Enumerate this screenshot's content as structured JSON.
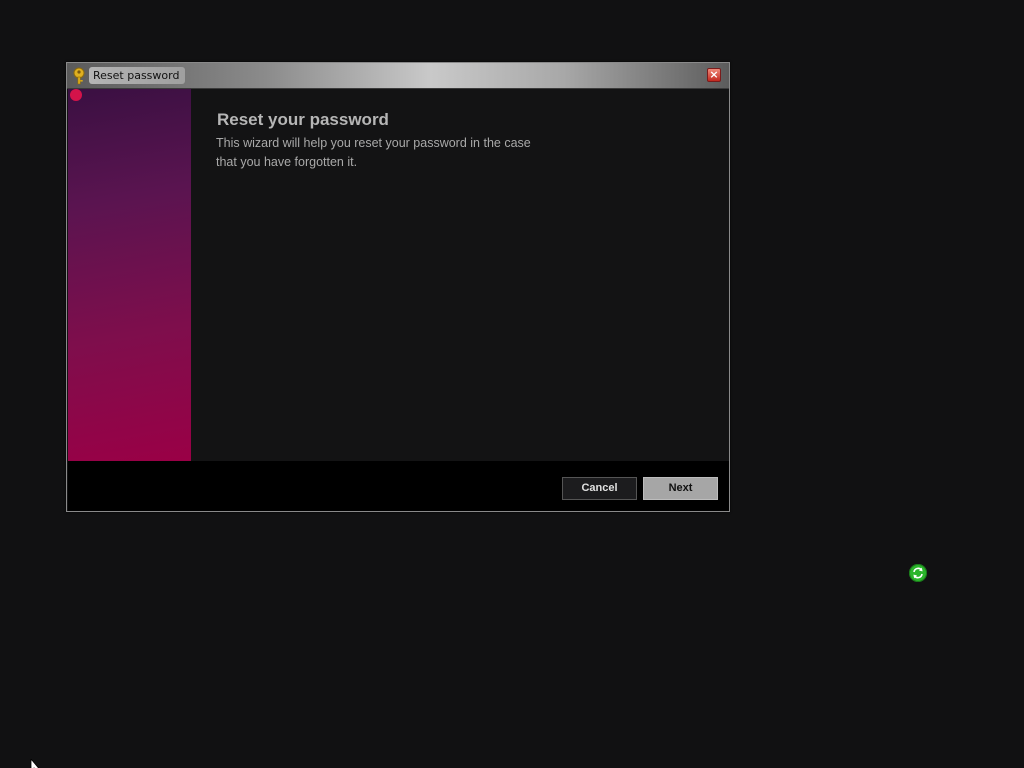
{
  "window": {
    "title": "Reset password",
    "close_symbol": "×"
  },
  "wizard": {
    "heading": "Reset your password",
    "description_line1": "This wizard will help you reset your password in the case",
    "description_line2": "that you have forgotten it."
  },
  "buttons": {
    "cancel": "Cancel",
    "next": "Next"
  },
  "icons": {
    "title_icon": "key-icon",
    "tray_icon": "sync-icon",
    "pointer": "mouse-cursor-icon"
  },
  "colors": {
    "desktop_bg": "#111112",
    "banner_top": "#3a1042",
    "banner_bottom": "#9a0046",
    "sync_green": "#2bb52b"
  }
}
